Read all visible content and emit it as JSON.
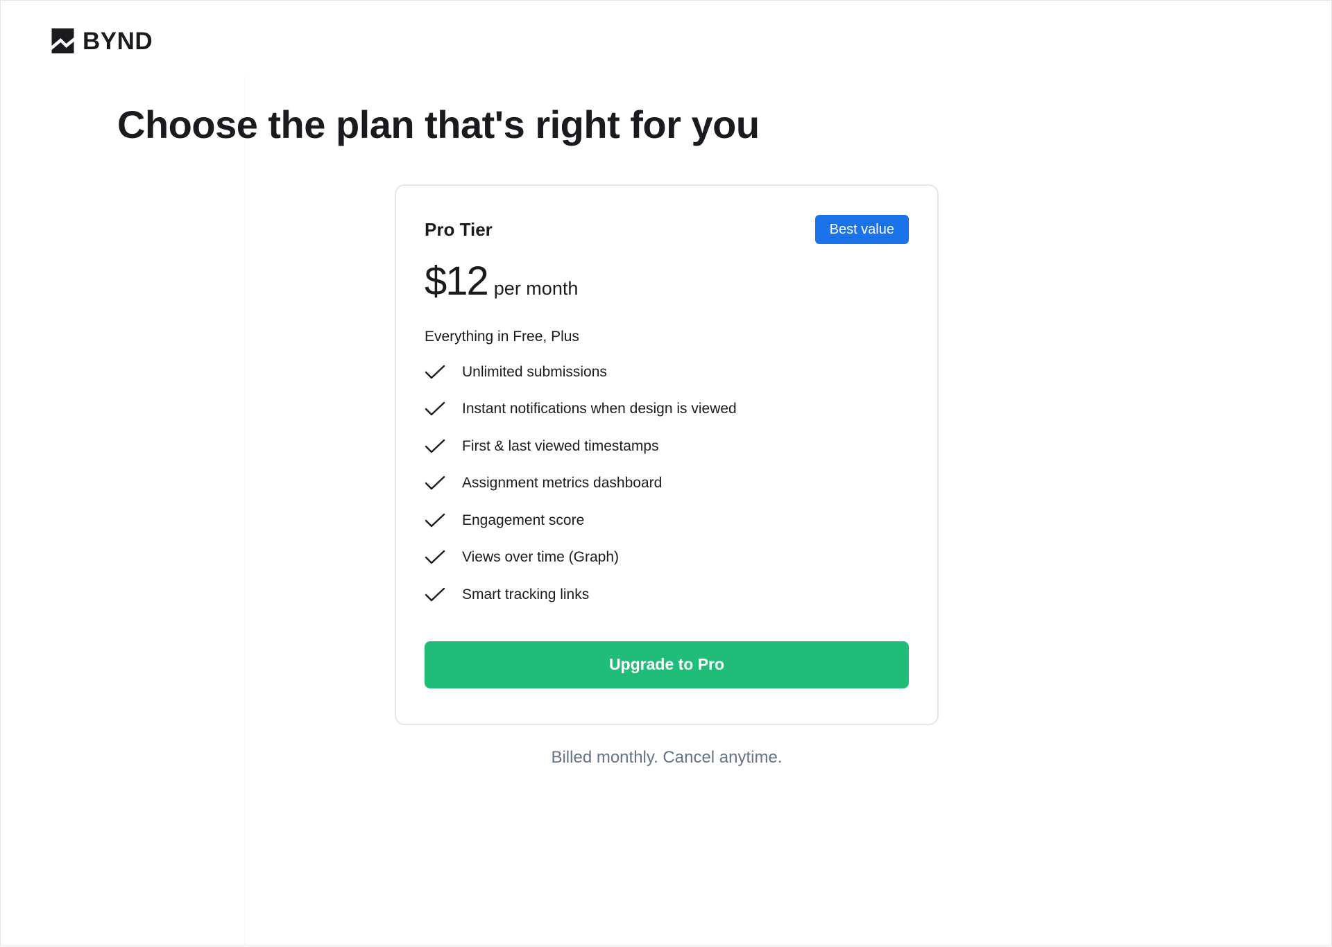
{
  "brand": {
    "name": "BYND",
    "logo_icon": "bynd-logo-icon"
  },
  "page": {
    "title": "Choose the plan that's right for you"
  },
  "plan": {
    "name": "Pro Tier",
    "badge": "Best value",
    "price": "$12",
    "period": "per month",
    "features_intro": "Everything in Free, Plus",
    "features": [
      {
        "label": "Unlimited submissions",
        "icon": "check-icon"
      },
      {
        "label": "Instant notifications when design is viewed",
        "icon": "check-icon"
      },
      {
        "label": "First & last viewed timestamps",
        "icon": "check-icon"
      },
      {
        "label": "Assignment metrics dashboard",
        "icon": "check-icon"
      },
      {
        "label": "Engagement score",
        "icon": "check-icon"
      },
      {
        "label": "Views over time (Graph)",
        "icon": "check-icon"
      },
      {
        "label": "Smart tracking links",
        "icon": "check-icon"
      }
    ],
    "cta_label": "Upgrade to Pro"
  },
  "footer": {
    "billing_note": "Billed monthly. Cancel anytime."
  },
  "colors": {
    "badge_bg": "#1a73e8",
    "cta_bg": "#20bd78",
    "note_text": "#64728a",
    "card_border": "#e3e5e9"
  }
}
